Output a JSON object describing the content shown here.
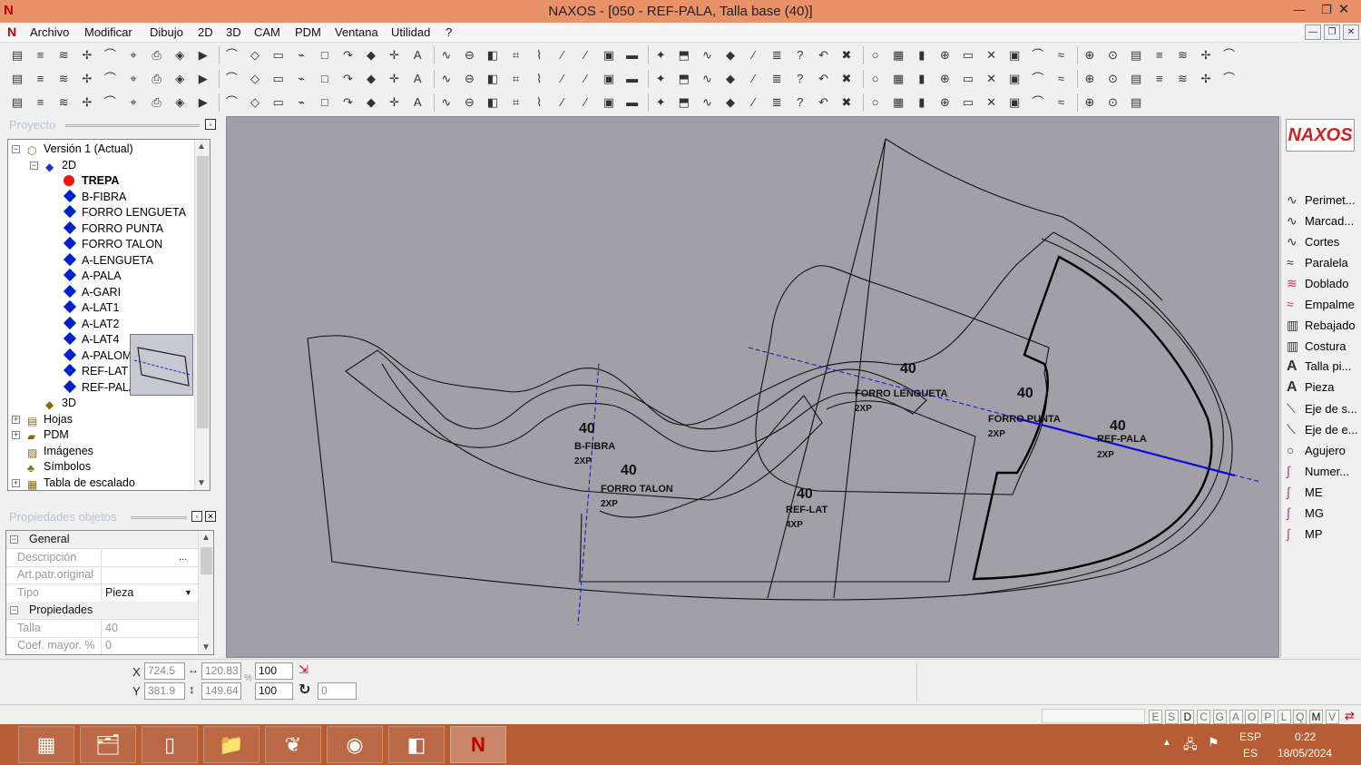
{
  "window": {
    "title": "NAXOS - [050 - REF-PALA, Talla base (40)]",
    "app_glyph": "N",
    "minimize": "—",
    "maximize": "❐",
    "close": "✕"
  },
  "menu": [
    "Archivo",
    "Modificar",
    "Dibujo",
    "2D",
    "3D",
    "CAM",
    "PDM",
    "Ventana",
    "Utilidad",
    "?"
  ],
  "project_panel": {
    "title": "Proyecto",
    "tree": [
      {
        "label": "Versión 1 (Actual)",
        "indent": 0,
        "exp": "−",
        "icon": "version-icon"
      },
      {
        "label": "2D",
        "indent": 1,
        "exp": "−",
        "icon": "folder-2d-icon"
      },
      {
        "label": "TREPA",
        "indent": 2,
        "icon": "red-dot",
        "bold": true
      },
      {
        "label": "B-FIBRA",
        "indent": 2,
        "icon": "diamond"
      },
      {
        "label": "FORRO LENGUETA",
        "indent": 2,
        "icon": "diamond"
      },
      {
        "label": "FORRO PUNTA",
        "indent": 2,
        "icon": "diamond"
      },
      {
        "label": "FORRO TALON",
        "indent": 2,
        "icon": "diamond"
      },
      {
        "label": "A-LENGUETA",
        "indent": 2,
        "icon": "diamond"
      },
      {
        "label": "A-PALA",
        "indent": 2,
        "icon": "diamond"
      },
      {
        "label": "A-GARI",
        "indent": 2,
        "icon": "diamond"
      },
      {
        "label": "A-LAT1",
        "indent": 2,
        "icon": "diamond"
      },
      {
        "label": "A-LAT2",
        "indent": 2,
        "icon": "diamond"
      },
      {
        "label": "A-LAT4",
        "indent": 2,
        "icon": "diamond"
      },
      {
        "label": "A-PALOMA",
        "indent": 2,
        "icon": "diamond"
      },
      {
        "label": "REF-LAT",
        "indent": 2,
        "icon": "diamond"
      },
      {
        "label": "REF-PALA",
        "indent": 2,
        "icon": "diamond"
      },
      {
        "label": "3D",
        "indent": 1,
        "icon": "folder-3d-icon"
      },
      {
        "label": "Hojas",
        "indent": 0,
        "exp": "+",
        "icon": "sheets-icon"
      },
      {
        "label": "PDM",
        "indent": 0,
        "exp": "+",
        "icon": "pdm-folder-icon"
      },
      {
        "label": "Imágenes",
        "indent": 0,
        "icon": "images-icon"
      },
      {
        "label": "Símbolos",
        "indent": 0,
        "icon": "symbols-icon"
      },
      {
        "label": "Tabla de escalado",
        "indent": 0,
        "exp": "+",
        "icon": "table-icon"
      }
    ]
  },
  "props_panel": {
    "title": "Propiedades objetos",
    "rows": [
      {
        "group": "General"
      },
      {
        "key": "Descripción",
        "value": "",
        "btn": "..."
      },
      {
        "key": "Art.patr.original",
        "value": ""
      },
      {
        "key": "Tipo",
        "value": "Pieza",
        "dropdown": true
      },
      {
        "group": "Propiedades"
      },
      {
        "key": "Talla",
        "value": "40"
      },
      {
        "key": "Coef. mayor. %",
        "value": "0"
      }
    ]
  },
  "canvas": {
    "size_label": "40",
    "pieces": [
      {
        "name": "B-FIBRA",
        "qty": "2XP"
      },
      {
        "name": "FORRO TALON",
        "qty": "2XP"
      },
      {
        "name": "FORRO LENGUETA",
        "qty": "2XP"
      },
      {
        "name": "FORRO PUNTA",
        "qty": "2XP"
      },
      {
        "name": "REF-PALA",
        "qty": "2XP"
      },
      {
        "name": "REF-LAT",
        "qty": "4XP"
      }
    ],
    "colors": {
      "background": "#a1a0a6",
      "line": "#111111",
      "axis": "#1a1ad0"
    }
  },
  "palette": {
    "logo": "NAXOS",
    "items": [
      {
        "label": "Perimet...",
        "icon": "curve-icon"
      },
      {
        "label": "Marcad...",
        "icon": "curve-icon"
      },
      {
        "label": "Cortes",
        "icon": "curve-icon"
      },
      {
        "label": "Paralela",
        "icon": "parallel-icon"
      },
      {
        "label": "Doblado",
        "icon": "fold-icon"
      },
      {
        "label": "Empalme",
        "icon": "join-icon"
      },
      {
        "label": "Rebajado",
        "icon": "skive-icon"
      },
      {
        "label": "Costura",
        "icon": "seam-icon"
      },
      {
        "label": "Talla pi...",
        "icon": "text-a-icon"
      },
      {
        "label": "Pieza",
        "icon": "text-a-icon"
      },
      {
        "label": "Eje de s...",
        "icon": "axis-icon"
      },
      {
        "label": "Eje de e...",
        "icon": "axis-icon"
      },
      {
        "label": "Agujero",
        "icon": "hole-icon"
      },
      {
        "label": "Numer...",
        "icon": "pen-icon"
      },
      {
        "label": "ME",
        "icon": "pen-icon"
      },
      {
        "label": "MG",
        "icon": "pen-icon"
      },
      {
        "label": "MP",
        "icon": "pen-icon"
      }
    ]
  },
  "coords": {
    "x_label": "X",
    "y_label": "Y",
    "x": "724.5",
    "y": "381.9",
    "w": "120.83",
    "h": "149.64",
    "pct_x": "100",
    "pct_y": "100",
    "angle": "0",
    "pct_sign": "%"
  },
  "status_flags": [
    "E",
    "S",
    "D",
    "C",
    "G",
    "A",
    "O",
    "P",
    "L",
    "Q",
    "M",
    "V"
  ],
  "tray": {
    "lang1": "ESP",
    "lang2": "ES",
    "time": "0:22",
    "date": "18/05/2024"
  }
}
